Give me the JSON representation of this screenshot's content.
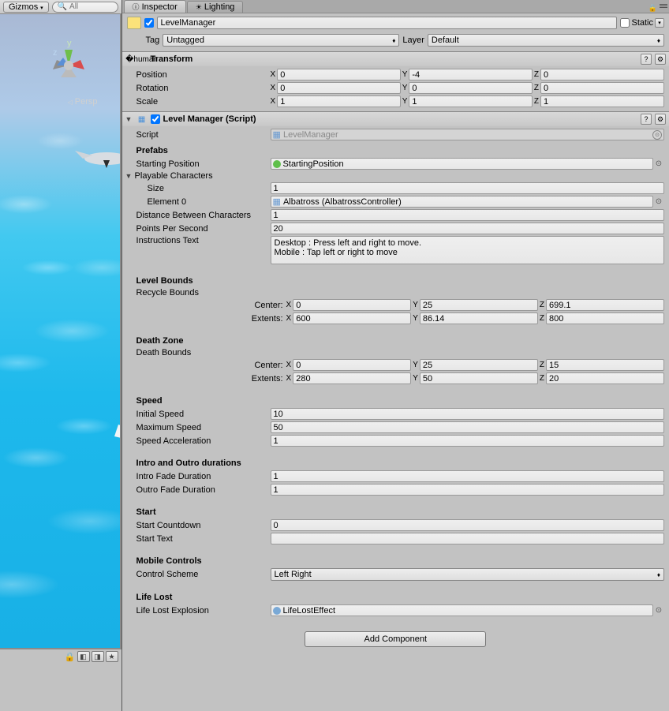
{
  "scene_toolbar": {
    "gizmos_label": "Gizmos",
    "search_placeholder": "All"
  },
  "viewport": {
    "persp_label": "Persp"
  },
  "tabs": {
    "inspector": "Inspector",
    "lighting": "Lighting"
  },
  "object": {
    "name": "LevelManager",
    "static_label": "Static",
    "tag_label": "Tag",
    "tag_value": "Untagged",
    "layer_label": "Layer",
    "layer_value": "Default"
  },
  "transform": {
    "title": "Transform",
    "position_label": "Position",
    "rotation_label": "Rotation",
    "scale_label": "Scale",
    "position": {
      "x": "0",
      "y": "-4",
      "z": "0"
    },
    "rotation": {
      "x": "0",
      "y": "0",
      "z": "0"
    },
    "scale": {
      "x": "1",
      "y": "1",
      "z": "1"
    }
  },
  "lm": {
    "title": "Level Manager (Script)",
    "script_label": "Script",
    "script_value": "LevelManager",
    "prefabs_header": "Prefabs",
    "starting_position_label": "Starting Position",
    "starting_position_value": "StartingPosition",
    "playable_characters_label": "Playable Characters",
    "size_label": "Size",
    "size_value": "1",
    "element0_label": "Element 0",
    "element0_value": "Albatross (AlbatrossController)",
    "distance_label": "Distance Between Characters",
    "distance_value": "1",
    "points_label": "Points Per Second",
    "points_value": "20",
    "instructions_label": "Instructions Text",
    "instructions_value": "Desktop : Press left and right to move.\nMobile : Tap left or right to move",
    "level_bounds_header": "Level Bounds",
    "recycle_bounds_label": "Recycle Bounds",
    "center_label": "Center:",
    "extents_label": "Extents:",
    "recycle_center": {
      "x": "0",
      "y": "25",
      "z": "699.1"
    },
    "recycle_extents": {
      "x": "600",
      "y": "86.14",
      "z": "800"
    },
    "death_zone_header": "Death Zone",
    "death_bounds_label": "Death Bounds",
    "death_center": {
      "x": "0",
      "y": "25",
      "z": "15"
    },
    "death_extents": {
      "x": "280",
      "y": "50",
      "z": "20"
    },
    "speed_header": "Speed",
    "initial_speed_label": "Initial Speed",
    "initial_speed_value": "10",
    "max_speed_label": "Maximum Speed",
    "max_speed_value": "50",
    "accel_label": "Speed Acceleration",
    "accel_value": "1",
    "intro_header": "Intro and Outro durations",
    "intro_fade_label": "Intro Fade Duration",
    "intro_fade_value": "1",
    "outro_fade_label": "Outro Fade Duration",
    "outro_fade_value": "1",
    "start_header": "Start",
    "start_countdown_label": "Start Countdown",
    "start_countdown_value": "0",
    "start_text_label": "Start Text",
    "start_text_value": "",
    "mobile_header": "Mobile Controls",
    "control_scheme_label": "Control Scheme",
    "control_scheme_value": "Left Right",
    "life_lost_header": "Life Lost",
    "life_lost_label": "Life Lost Explosion",
    "life_lost_value": "LifeLostEffect"
  },
  "add_component_label": "Add Component",
  "axes": {
    "x": "X",
    "y": "Y",
    "z": "Z"
  }
}
